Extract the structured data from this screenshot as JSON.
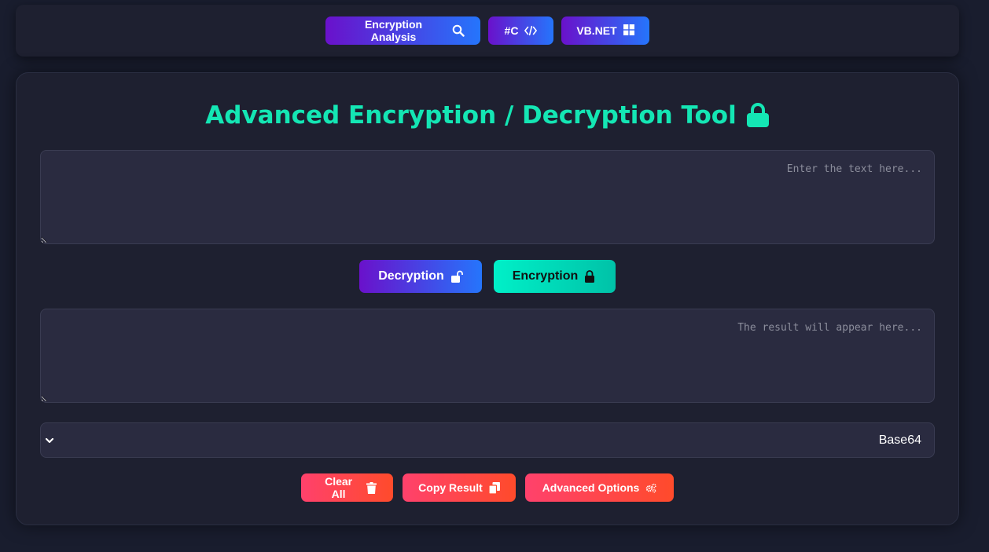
{
  "nav": {
    "items": [
      {
        "label": "Encryption Analysis",
        "icon": "search-icon"
      },
      {
        "label": "#C",
        "icon": "code-icon"
      },
      {
        "label": "VB.NET",
        "icon": "windows-icon"
      }
    ]
  },
  "main": {
    "title": "Advanced Encryption / Decryption Tool",
    "title_icon": "lock-icon",
    "input_placeholder": "...Enter the text here",
    "output_placeholder": "...The result will appear here",
    "decrypt_label": "Decryption",
    "encrypt_label": "Encryption",
    "algorithm": {
      "selected": "Base64"
    },
    "buttons": {
      "clear": "Clear All",
      "copy": "Copy Result",
      "advanced": "Advanced Options"
    }
  },
  "colors": {
    "accent": "#14e6b4",
    "primary_gradient_start": "#6a11cb",
    "primary_gradient_end": "#2575fc",
    "danger_gradient_start": "#ff416c",
    "danger_gradient_end": "#ff4b2b",
    "background": "#191d2e",
    "panel": "#1e2030"
  }
}
